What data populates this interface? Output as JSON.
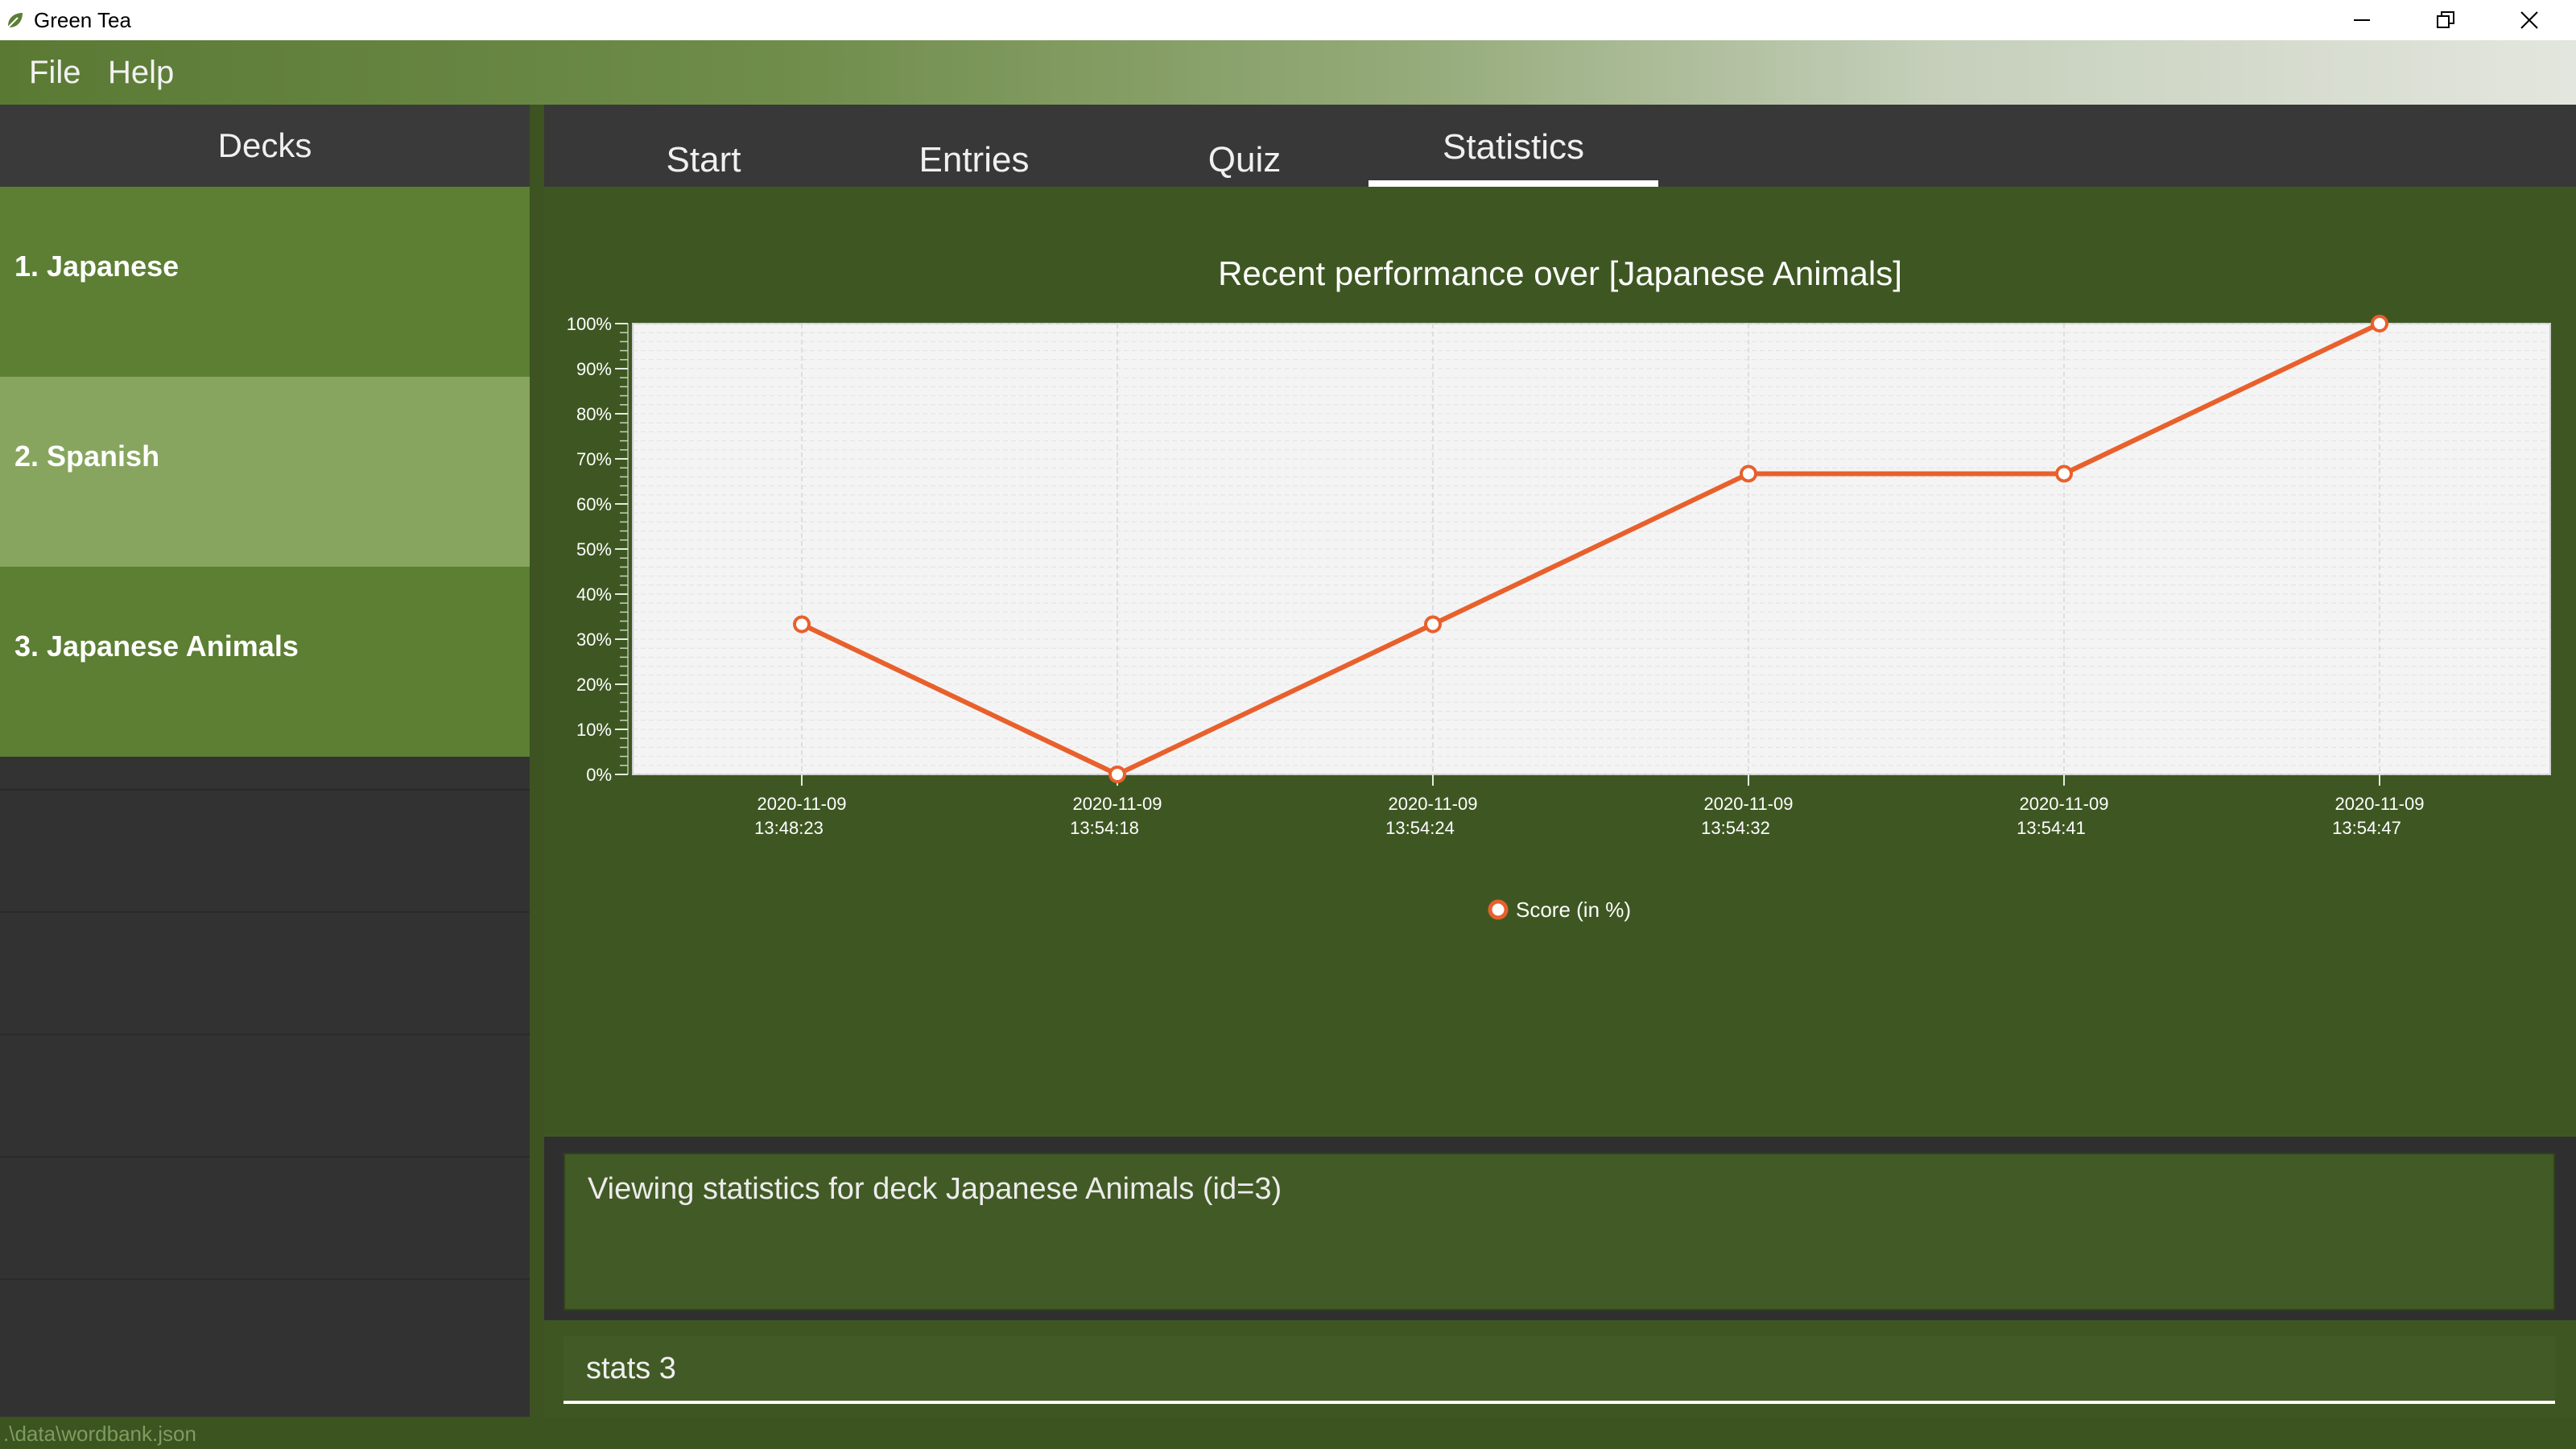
{
  "window": {
    "title": "Green Tea",
    "icon": "tea-leaf-icon"
  },
  "menu": {
    "file": "File",
    "help": "Help"
  },
  "decks": {
    "header": "Decks",
    "items": [
      {
        "label": "1.  Japanese",
        "selected": false
      },
      {
        "label": "2.  Spanish",
        "selected": true
      },
      {
        "label": "3.  Japanese Animals",
        "selected": false
      }
    ]
  },
  "tabs": [
    {
      "label": "Start",
      "active": false
    },
    {
      "label": "Entries",
      "active": false
    },
    {
      "label": "Quiz",
      "active": false
    },
    {
      "label": "Statistics",
      "active": true
    }
  ],
  "chart_data": {
    "type": "line",
    "title": "Recent performance over [Japanese Animals]",
    "x": [
      "2020-11-09 13:48:23",
      "2020-11-09 13:54:18",
      "2020-11-09 13:54:24",
      "2020-11-09 13:54:32",
      "2020-11-09 13:54:41",
      "2020-11-09 13:54:47"
    ],
    "series": [
      {
        "name": "Score (in %)",
        "values": [
          33.3,
          0,
          33.3,
          66.7,
          66.7,
          100
        ]
      }
    ],
    "ylim": [
      0,
      100
    ],
    "yticks": [
      "0%",
      "10%",
      "20%",
      "30%",
      "40%",
      "50%",
      "60%",
      "70%",
      "80%",
      "90%",
      "100%"
    ],
    "grid": true,
    "legend": "bottom-center",
    "line_color": "#e8602c"
  },
  "result": {
    "text": "Viewing statistics for deck Japanese Animals (id=3)"
  },
  "command": {
    "value": "stats 3"
  },
  "status": {
    "path": ".\\data\\wordbank.json"
  },
  "colors": {
    "deck_item": "#5c7f33",
    "deck_item_selected": "#87a55e",
    "accent": "#e8602c"
  }
}
